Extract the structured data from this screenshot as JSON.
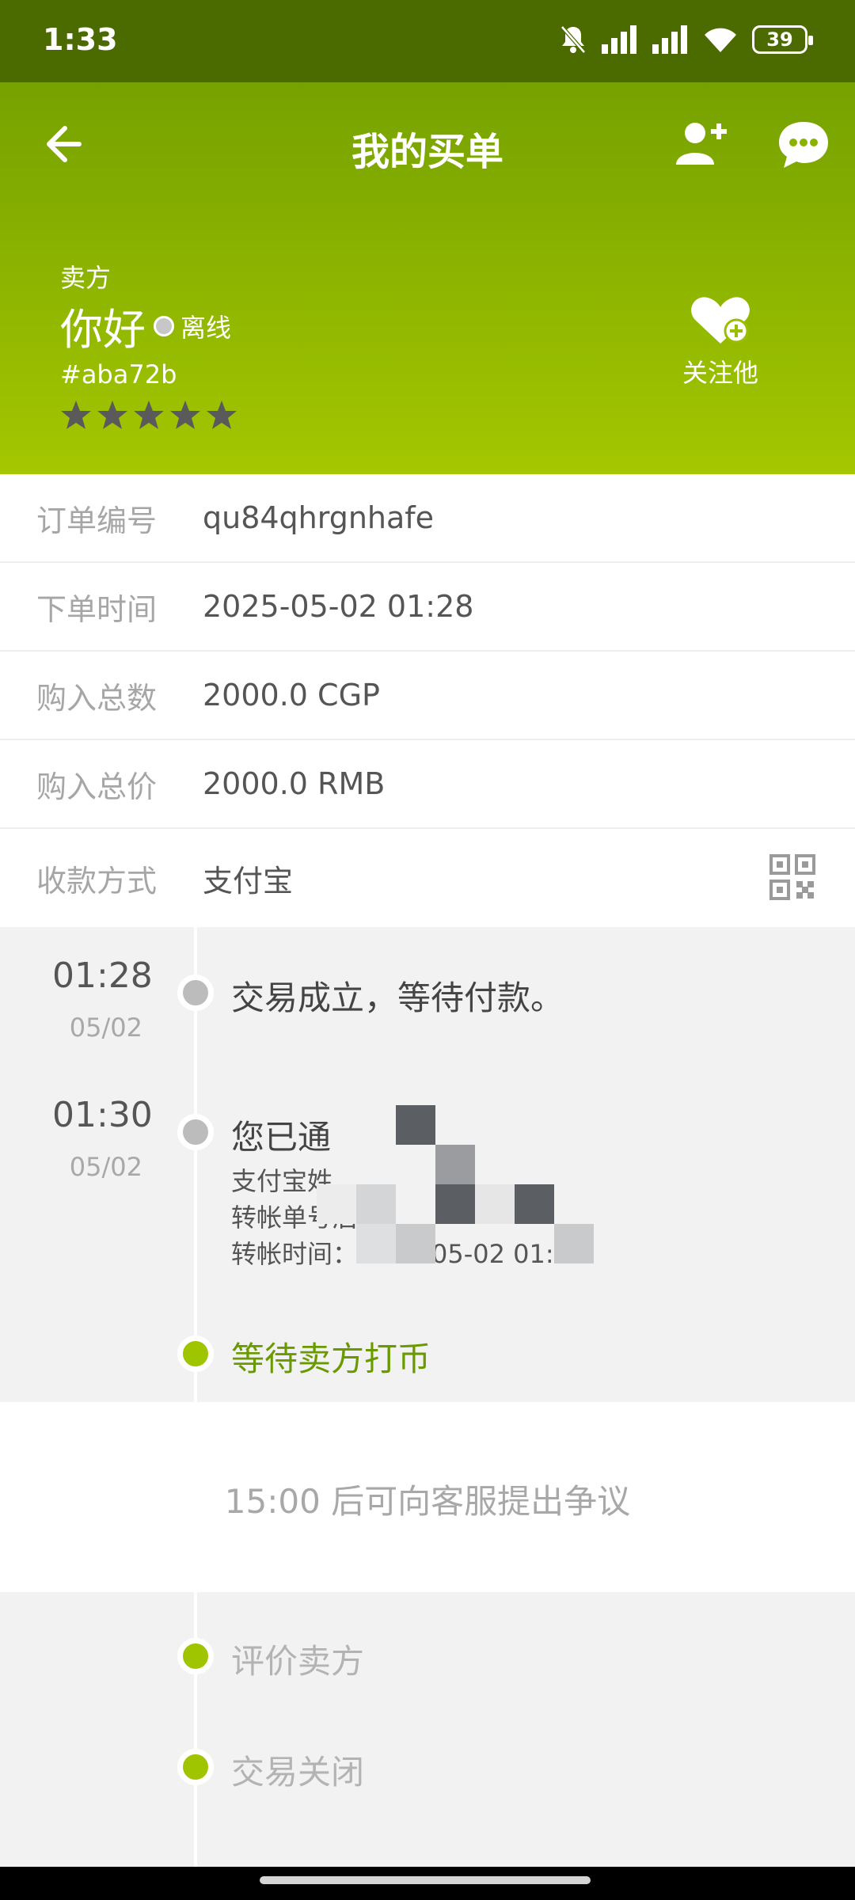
{
  "status_bar": {
    "time": "1:33",
    "battery": "39"
  },
  "header": {
    "title": "我的买单"
  },
  "seller": {
    "label": "卖方",
    "name": "你好",
    "status": "离线",
    "id": "#aba72b",
    "rating_stars": 5,
    "follow_label": "关注他"
  },
  "details": [
    {
      "key": "订单编号",
      "value": "qu84qhrgnhafe"
    },
    {
      "key": "下单时间",
      "value": "2025-05-02 01:28"
    },
    {
      "key": "购入总数",
      "value": "2000.0 CGP"
    },
    {
      "key": "购入总价",
      "value": "2000.0 RMB"
    },
    {
      "key": "收款方式",
      "value": "支付宝"
    }
  ],
  "timeline": {
    "event1": {
      "time": "01:28",
      "date": "05/02",
      "text": "交易成立，等待付款。"
    },
    "event2": {
      "time": "01:30",
      "date": "05/02",
      "text": "您已通",
      "line1": "支付宝姓",
      "line2": "转帐单号后",
      "line3": "转帐时间：2025-05-02 01:29"
    },
    "current": "等待卖方打币"
  },
  "dispute": {
    "text": "15:00 后可向客服提出争议"
  },
  "future_steps": [
    "评价卖方",
    "交易关闭"
  ],
  "colors": {
    "header_top": "#76a100",
    "header_bottom": "#a4c700",
    "accent_green": "#9fc400",
    "status_bar": "#4b6a00"
  }
}
